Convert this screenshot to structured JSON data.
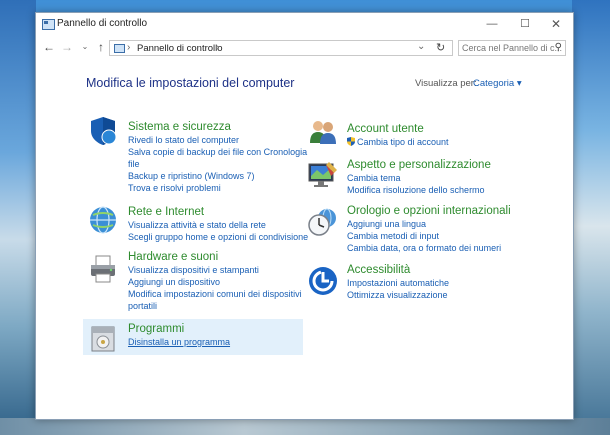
{
  "window": {
    "title": "Pannello di controllo",
    "controls": {
      "minimize": "—",
      "maximize": "☐",
      "close": "✕"
    }
  },
  "nav": {
    "back": "←",
    "forward": "→",
    "recent": "⌄",
    "up": "↑",
    "address_sep": "›",
    "address": "Pannello di controllo",
    "address_sep2": "›",
    "address_dropdown": "⌄",
    "refresh": "↻",
    "search_placeholder": "Cerca nel Pannello di c...",
    "search_icon": "⚲"
  },
  "header": {
    "title": "Modifica le impostazioni del computer",
    "view_by_label": "Visualizza per:",
    "view_by_value": "Categoria ▾"
  },
  "categories": [
    {
      "id": "sistema",
      "title": "Sistema e sicurezza",
      "icon": "shield-icon",
      "links": [
        "Rivedi lo stato del computer",
        "Salva copie di backup dei file con Cronologia",
        "file",
        "Backup e ripristino (Windows 7)",
        "Trova e risolvi problemi"
      ]
    },
    {
      "id": "rete",
      "title": "Rete e Internet",
      "icon": "network-globe-icon",
      "links": [
        "Visualizza attività e stato della rete",
        "Scegli gruppo home e opzioni di condivisione"
      ]
    },
    {
      "id": "hardware",
      "title": "Hardware e suoni",
      "icon": "printer-icon",
      "links": [
        "Visualizza dispositivi e stampanti",
        "Aggiungi un dispositivo",
        "Modifica impostazioni comuni dei dispositivi",
        "portatili"
      ]
    },
    {
      "id": "programmi",
      "title": "Programmi",
      "icon": "programs-box-icon",
      "links": [
        "Disinstalla un programma"
      ]
    },
    {
      "id": "account",
      "title": "Account utente",
      "icon": "users-icon",
      "links": [
        "Cambia tipo di account"
      ]
    },
    {
      "id": "aspetto",
      "title": "Aspetto e personalizzazione",
      "icon": "monitor-paint-icon",
      "links": [
        "Cambia tema",
        "Modifica risoluzione dello schermo"
      ]
    },
    {
      "id": "orologio",
      "title": "Orologio e opzioni internazionali",
      "icon": "clock-globe-icon",
      "links": [
        "Aggiungi una lingua",
        "Cambia metodi di input",
        "Cambia data, ora o formato dei numeri"
      ]
    },
    {
      "id": "accessibilita",
      "title": "Accessibilità",
      "icon": "accessibility-icon",
      "links": [
        "Impostazioni automatiche",
        "Ottimizza visualizzazione"
      ]
    }
  ],
  "colors": {
    "category_title": "#2e8b2e",
    "link": "#1a5fb4",
    "page_title": "#1e3287",
    "hover_highlight": "#e2f0fb"
  }
}
